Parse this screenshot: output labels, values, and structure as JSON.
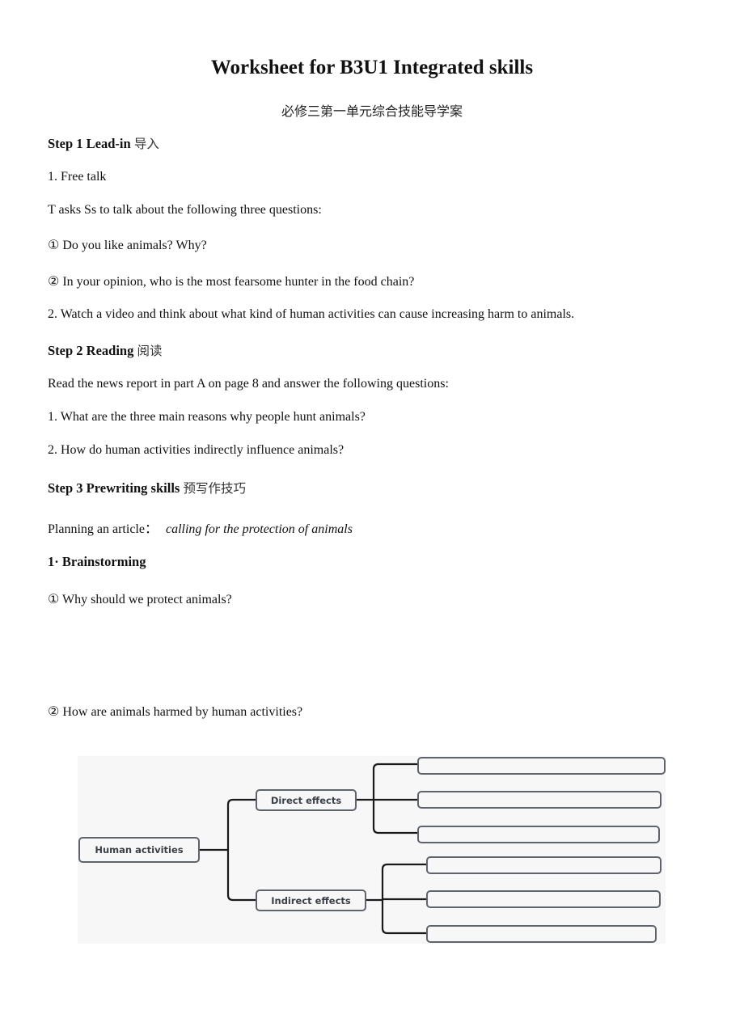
{
  "document": {
    "title": "Worksheet for B3U1 Integrated skills",
    "subtitle": "必修三第一单元综合技能导学案"
  },
  "step1": {
    "heading": "Step 1 Lead-in",
    "heading_cn": "导入",
    "item1": "1. Free talk",
    "intro": "T asks Ss to talk about the following three questions:",
    "q1": "① Do you like animals? Why?",
    "q2": "② In your opinion, who is the most fearsome hunter in the food chain?",
    "item2": "2.  Watch a video and think about what kind of human activities can cause increasing harm to animals."
  },
  "step2": {
    "heading": "Step 2 Reading",
    "heading_cn": "阅读",
    "intro": "Read the news report in part A on page 8 and answer the following questions:",
    "q1": "1. What are the three main reasons why people hunt animals?",
    "q2": "2.  How do human activities indirectly influence animals?"
  },
  "step3": {
    "heading": "Step 3 Prewriting skills",
    "heading_cn": "预写作技巧",
    "planning_label": "Planning an article：",
    "planning_topic": "calling for the protection of animals",
    "brainstorming": "1· Brainstorming",
    "q1": "① Why should we protect animals?",
    "q2": "② How are animals harmed by human activities?"
  },
  "mindmap": {
    "root": "Human activities",
    "branches": [
      {
        "label": "Direct effects",
        "blank_count": 3
      },
      {
        "label": "Indirect effects",
        "blank_count": 3
      }
    ]
  }
}
